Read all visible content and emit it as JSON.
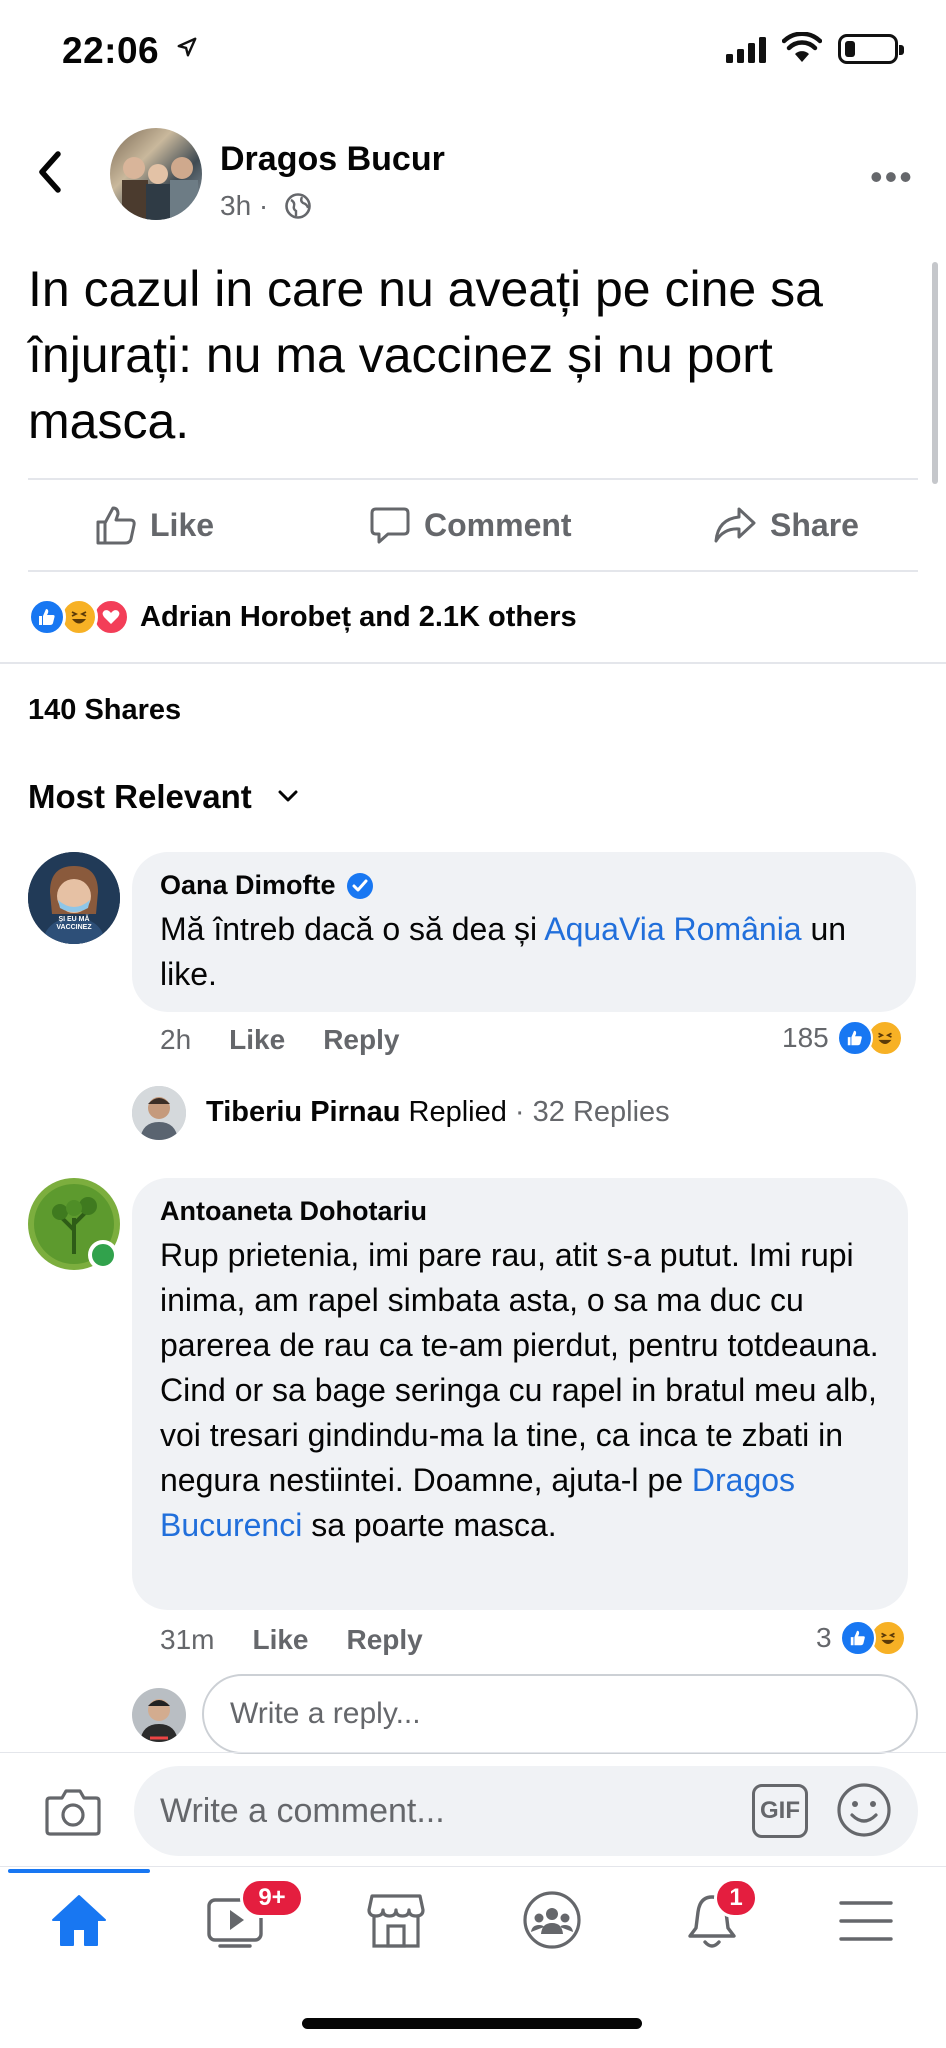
{
  "status_bar": {
    "time": "22:06"
  },
  "post": {
    "author": "Dragos Bucur",
    "time": "3h",
    "text": "In cazul in care nu aveați pe cine sa înjurați: nu ma vaccinez și nu port masca.",
    "actions": {
      "like": "Like",
      "comment": "Comment",
      "share": "Share"
    },
    "reactions_text": "Adrian Horobeț and 2.1K others",
    "shares": "140 Shares",
    "sort_label": "Most Relevant"
  },
  "comments": [
    {
      "name": "Oana Dimofte",
      "verified": true,
      "text_before": "Mă întreb dacă o să dea și ",
      "link": "AquaVia România",
      "text_after": " un like.",
      "time": "2h",
      "like_label": "Like",
      "reply_label": "Reply",
      "reaction_count": "185",
      "avatar_text": "ȘI EU MĂ VACCINEZ",
      "reply_summary": {
        "name": "Tiberiu Pirnau",
        "action": "Replied",
        "count": "· 32 Replies"
      }
    },
    {
      "name": "Antoaneta Dohotariu",
      "text_before": "Rup prietenia, imi pare rau, atit s-a putut. Imi rupi inima, am rapel simbata asta, o sa ma duc cu parerea de rau ca te-am pierdut, pentru totdeauna. Cind or sa bage seringa cu rapel in bratul meu alb, voi tresari gindindu-ma la tine, ca inca te zbati in negura nestiintei. Doamne, ajuta-l pe ",
      "link": "Dragos Bucurenci",
      "text_after": " sa poarte masca.",
      "time": "31m",
      "like_label": "Like",
      "reply_label": "Reply",
      "reaction_count": "3",
      "online": true
    }
  ],
  "reply_box": {
    "placeholder": "Write a reply..."
  },
  "comment_box": {
    "placeholder": "Write a comment...",
    "gif_label": "GIF"
  },
  "tab_bar": {
    "watch_badge": "9+",
    "notifications_badge": "1"
  },
  "colors": {
    "accent": "#1877f2",
    "link": "#216fdb",
    "badge": "#e41e3f",
    "online": "#31a24c"
  }
}
